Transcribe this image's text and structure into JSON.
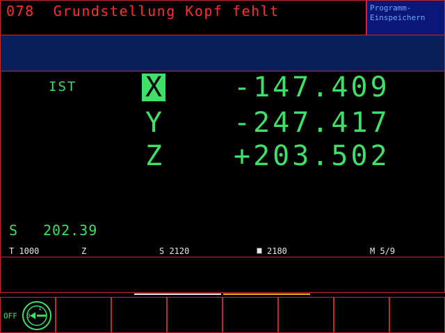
{
  "header": {
    "message": "078  Grundstellung Kopf fehlt",
    "program_box": [
      "Programm-",
      "Einspeichern"
    ]
  },
  "position": {
    "mode_label": "IST",
    "axes": [
      {
        "axis": "X",
        "value": "-147.409",
        "selected": true
      },
      {
        "axis": "Y",
        "value": "-247.417",
        "selected": false
      },
      {
        "axis": "Z",
        "value": "+203.502",
        "selected": false
      }
    ]
  },
  "spindle": {
    "label": "S",
    "value": "202.39"
  },
  "status_line": {
    "tool": "T 1000",
    "axis": "Z",
    "speed": "S 2120",
    "feed": "2180",
    "feed_icon": "feed-icon",
    "m_function": "M 5/9"
  },
  "softkeys": {
    "off_label": "OFF",
    "dial_icon": "spindle-override-dial-icon",
    "dial_numbers": [
      "0",
      "1"
    ]
  },
  "colors": {
    "accent_red": "#c82828",
    "message_red": "#ff3030",
    "display_green": "#3ee06a",
    "band_blue": "#08205a",
    "program_box_blue": "#0a1678"
  }
}
